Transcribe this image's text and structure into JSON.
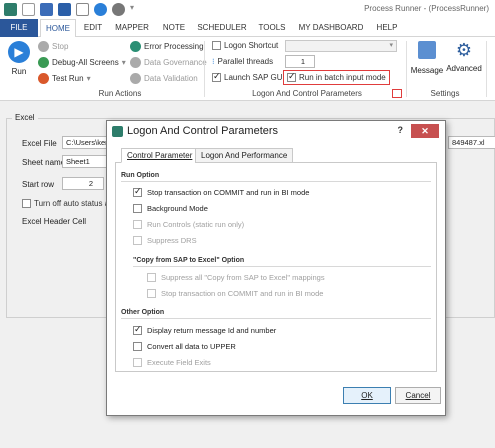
{
  "app_title": "Process Runner - (ProcessRunner)",
  "tabs": [
    "FILE",
    "HOME",
    "EDIT",
    "MAPPER",
    "NOTE",
    "SCHEDULER",
    "TOOLS",
    "MY DASHBOARD",
    "HELP"
  ],
  "ribbon": {
    "run_label": "Run",
    "stop_label": "Stop",
    "debug_label": "Debug-All Screens",
    "test_run_label": "Test Run",
    "error_processing_label": "Error Processing",
    "data_governance_label": "Data Governance",
    "data_validation_label": "Data Validation",
    "run_actions_group": "Run Actions",
    "logon_shortcut_label": "Logon Shortcut",
    "parallel_threads_label": "Parallel threads",
    "parallel_threads_value": "1",
    "launch_sap_gui_label": "Launch SAP GUI",
    "batch_input_label": "Run in batch input mode",
    "logon_group": "Logon And Control Parameters",
    "message_label": "Message",
    "advanced_label": "Advanced",
    "settings_group": "Settings"
  },
  "main": {
    "excel_group": "Excel",
    "excel_file_label": "Excel File",
    "excel_file_value": "C:\\Users\\ker",
    "excel_file_tail": "849487.xl",
    "sheet_name_label": "Sheet name",
    "sheet_name_value": "Sheet1",
    "start_row_label": "Start row",
    "start_row_value": "2",
    "turn_off_label": "Turn off auto status and",
    "header_cell_label": "Excel Header Cell"
  },
  "dialog": {
    "title": "Logon And Control Parameters",
    "help": "?",
    "close": "✕",
    "tab_control": "Control Parameter",
    "tab_logon": "Logon And Performance",
    "run_option": "Run Option",
    "stop_transaction": "Stop transaction on COMMIT and run in BI mode",
    "background_mode": "Background Mode",
    "run_controls": "Run Controls (static run only)",
    "suppress_drs": "Suppress DRS",
    "copy_section": "\"Copy from SAP to Excel\" Option",
    "suppress_all": "Suppress all \"Copy from SAP to Excel\" mappings",
    "stop_transaction2": "Stop transaction on COMMIT and run in BI mode",
    "other_option": "Other Option",
    "display_return": "Display return message Id and number",
    "convert_upper": "Convert all data to UPPER",
    "execute_exits": "Execute Field Exits",
    "ok": "OK",
    "cancel": "Cancel"
  },
  "colors": {
    "accent": "#2b579a",
    "highlight": "#e03c3c"
  }
}
